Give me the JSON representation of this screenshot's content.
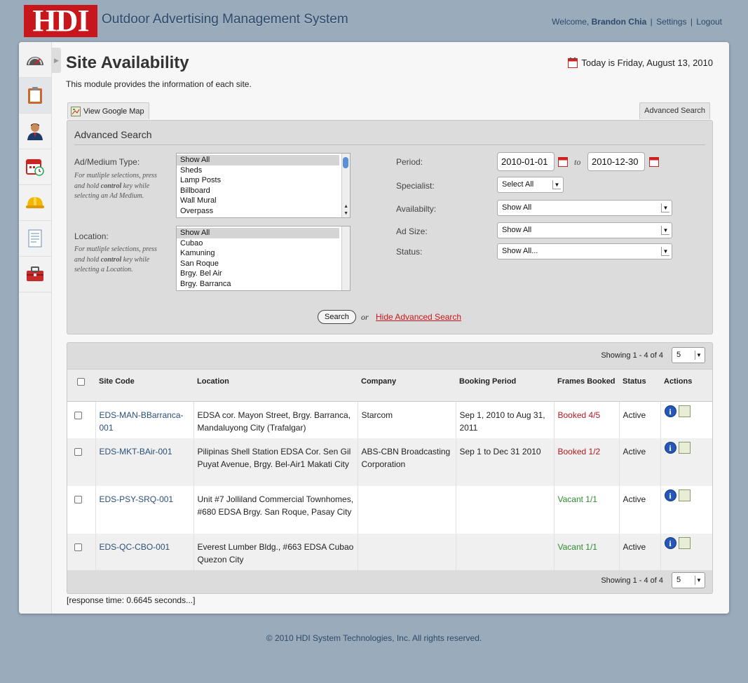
{
  "header": {
    "logo_text": "HDI",
    "app_title": "Outdoor Advertising Management System",
    "welcome_prefix": "Welcome,",
    "user_name": "Brandon Chia",
    "settings_label": "Settings",
    "logout_label": "Logout"
  },
  "sidebar": {
    "items": [
      {
        "icon": "dashboard-gauge-icon"
      },
      {
        "icon": "clipboard-icon"
      },
      {
        "icon": "user-icon"
      },
      {
        "icon": "calendar-clock-icon"
      },
      {
        "icon": "hardhat-icon"
      },
      {
        "icon": "document-list-icon"
      },
      {
        "icon": "toolbox-icon"
      }
    ]
  },
  "page": {
    "title": "Site Availability",
    "today": "Today is Friday, August 13, 2010",
    "subtitle": "This module provides the information of each site.",
    "view_map_label": "View Google Map",
    "advanced_search_tab_label": "Advanced Search"
  },
  "advanced_search": {
    "title": "Advanced Search",
    "ad_medium_label": "Ad/Medium Type:",
    "ad_medium_hint_1": "For mutliple selections, press and hold ",
    "ad_medium_hint_bold": "control",
    "ad_medium_hint_2": " key while selecting an Ad Medium.",
    "ad_medium_options": [
      "Show All",
      "Sheds",
      "Lamp Posts",
      "Billboard",
      "Wall Mural",
      "Overpass"
    ],
    "location_label": "Location:",
    "location_hint_1": "For mutliple selections, press and hold ",
    "location_hint_bold": "control",
    "location_hint_2": " key while selecting a Location.",
    "location_options": [
      "Show All",
      "Cubao",
      "Kamuning",
      "San Roque",
      "Brgy. Bel Air",
      "Brgy. Barranca"
    ],
    "period_label": "Period:",
    "period_from": "2010-01-01",
    "period_to_word": "to",
    "period_to": "2010-12-30",
    "specialist_label": "Specialist:",
    "specialist_value": "Select All",
    "availability_label": "Availabilty:",
    "availability_value": "Show All",
    "ad_size_label": "Ad Size:",
    "ad_size_value": "Show All",
    "status_label": "Status:",
    "status_value": "Show All...",
    "search_button": "Search",
    "or_word": "or",
    "hide_link": "Hide Advanced Search"
  },
  "results": {
    "showing_text": "Showing 1 - 4 of 4",
    "page_size": "5",
    "columns": [
      "Site Code",
      "Location",
      "Company",
      "Booking Period",
      "Frames Booked",
      "Status",
      "Actions"
    ],
    "rows": [
      {
        "site_code": "EDS-MAN-BBarranca-001",
        "location": "EDSA cor. Mayon Street, Brgy. Barranca, Mandaluyong City (Trafalgar)",
        "company": "Starcom",
        "booking_period": "Sep 1, 2010 to Aug 31, 2011",
        "frames": "Booked 4/5",
        "frames_state": "booked",
        "status": "Active"
      },
      {
        "site_code": "EDS-MKT-BAir-001",
        "location": "Pilipinas Shell Station EDSA Cor. Sen Gil Puyat Avenue, Brgy. Bel-Air1 Makati City",
        "company": "ABS-CBN Broadcasting Corporation",
        "booking_period": "Sep 1 to Dec 31 2010",
        "frames": "Booked 1/2",
        "frames_state": "booked",
        "status": "Active"
      },
      {
        "site_code": "EDS-PSY-SRQ-001",
        "location": "Unit #7 Jolliland Commercial Townhomes, #680 EDSA Brgy. San Roque, Pasay City",
        "company": "",
        "booking_period": "",
        "frames": "Vacant 1/1",
        "frames_state": "vacant",
        "status": "Active"
      },
      {
        "site_code": "EDS-QC-CBO-001",
        "location": "Everest Lumber Bldg., #663 EDSA Cubao Quezon City",
        "company": "",
        "booking_period": "",
        "frames": "Vacant 1/1",
        "frames_state": "vacant",
        "status": "Active"
      }
    ],
    "response_time": "[response time: 0.6645 seconds...]"
  },
  "footer": {
    "copyright": "© 2010 HDI System Technologies, Inc. All rights reserved."
  },
  "colors": {
    "background": "#9aabbb",
    "brand_red": "#c8161d",
    "link_blue": "#2b4f7a",
    "booked_red": "#b3171d",
    "vacant_green": "#2e8a2e"
  }
}
